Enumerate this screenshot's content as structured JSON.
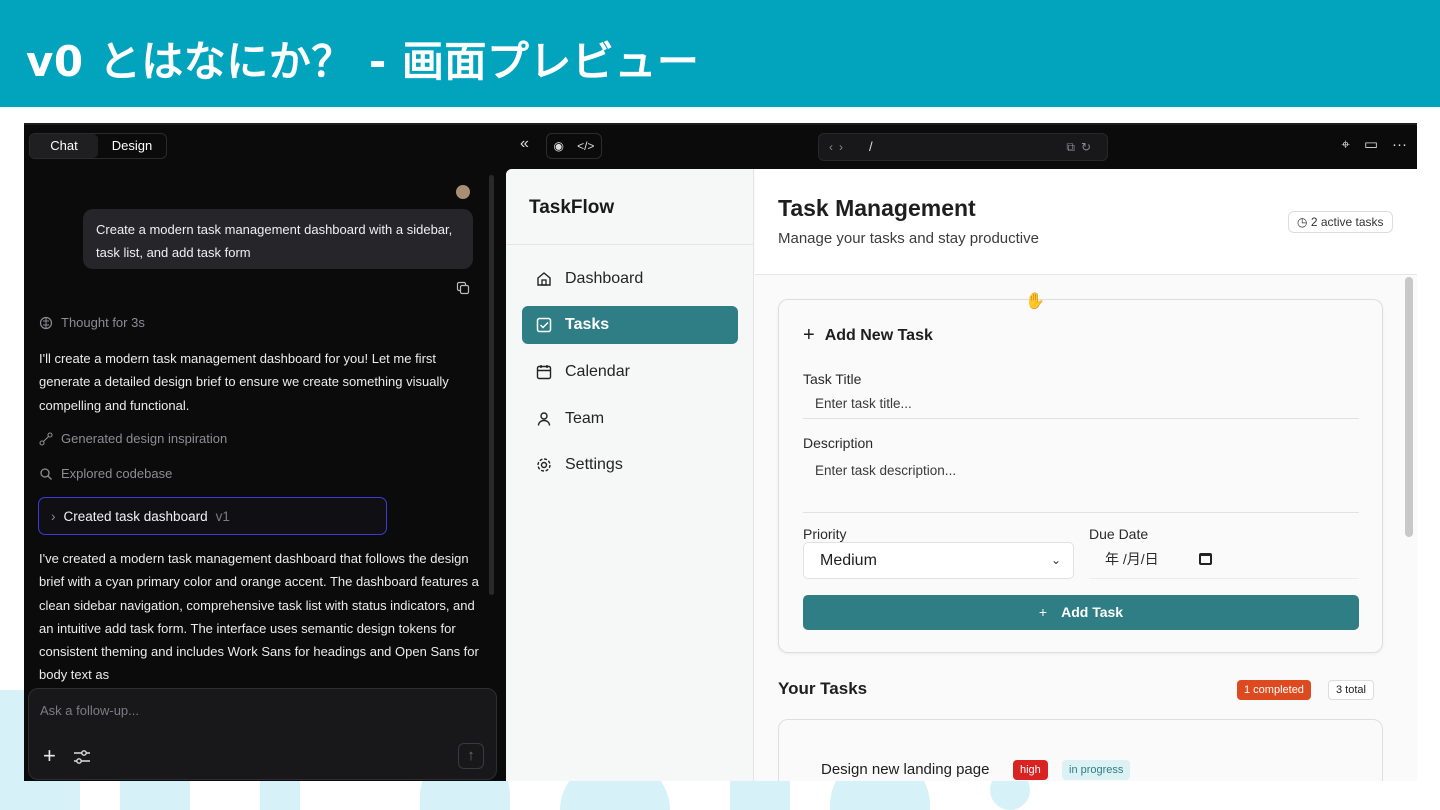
{
  "slide": {
    "title": "v0 とはなにか？ - 画面プレビュー"
  },
  "chat": {
    "tabs": [
      "Chat",
      "Design"
    ],
    "user_message": "Create a modern task management dashboard with a sidebar, task list, and add task form",
    "thought": "Thought for 3s",
    "intro": "I'll create a modern task management dashboard for you! Let me first generate a detailed design brief to ensure we create something visually compelling and functional.",
    "steps": [
      "Generated design inspiration",
      "Explored codebase"
    ],
    "created_label": "Created task dashboard",
    "created_version": "v1",
    "summary": "I've created a modern task management dashboard that follows the design brief with a cyan primary color and orange accent. The dashboard features a clean sidebar navigation, comprehensive task list with status indicators, and an intuitive add task form. The interface uses semantic design tokens for consistent theming and includes Work Sans for headings and Open Sans for body text as",
    "composer_placeholder": "Ask a follow-up..."
  },
  "toolbar": {
    "url_path": "/"
  },
  "app": {
    "brand": "TaskFlow",
    "nav": [
      "Dashboard",
      "Tasks",
      "Calendar",
      "Team",
      "Settings"
    ],
    "title": "Task Management",
    "subtitle": "Manage your tasks and stay productive",
    "active_tasks": "2 active tasks",
    "form": {
      "title": "Add New Task",
      "task_title_label": "Task Title",
      "task_title_placeholder": "Enter task title...",
      "description_label": "Description",
      "description_placeholder": "Enter task description...",
      "priority_label": "Priority",
      "priority_value": "Medium",
      "due_label": "Due Date",
      "due_placeholder": "年 /月/日",
      "submit": "Add Task"
    },
    "tasks": {
      "heading": "Your Tasks",
      "completed": "1 completed",
      "total": "3 total",
      "first_task": "Design new landing page",
      "first_priority": "high",
      "first_status": "in progress"
    }
  },
  "colors": {
    "header": "#01a3bd",
    "primary": "#2f7e85",
    "high": "#d92323",
    "completed": "#dd4a1f"
  }
}
